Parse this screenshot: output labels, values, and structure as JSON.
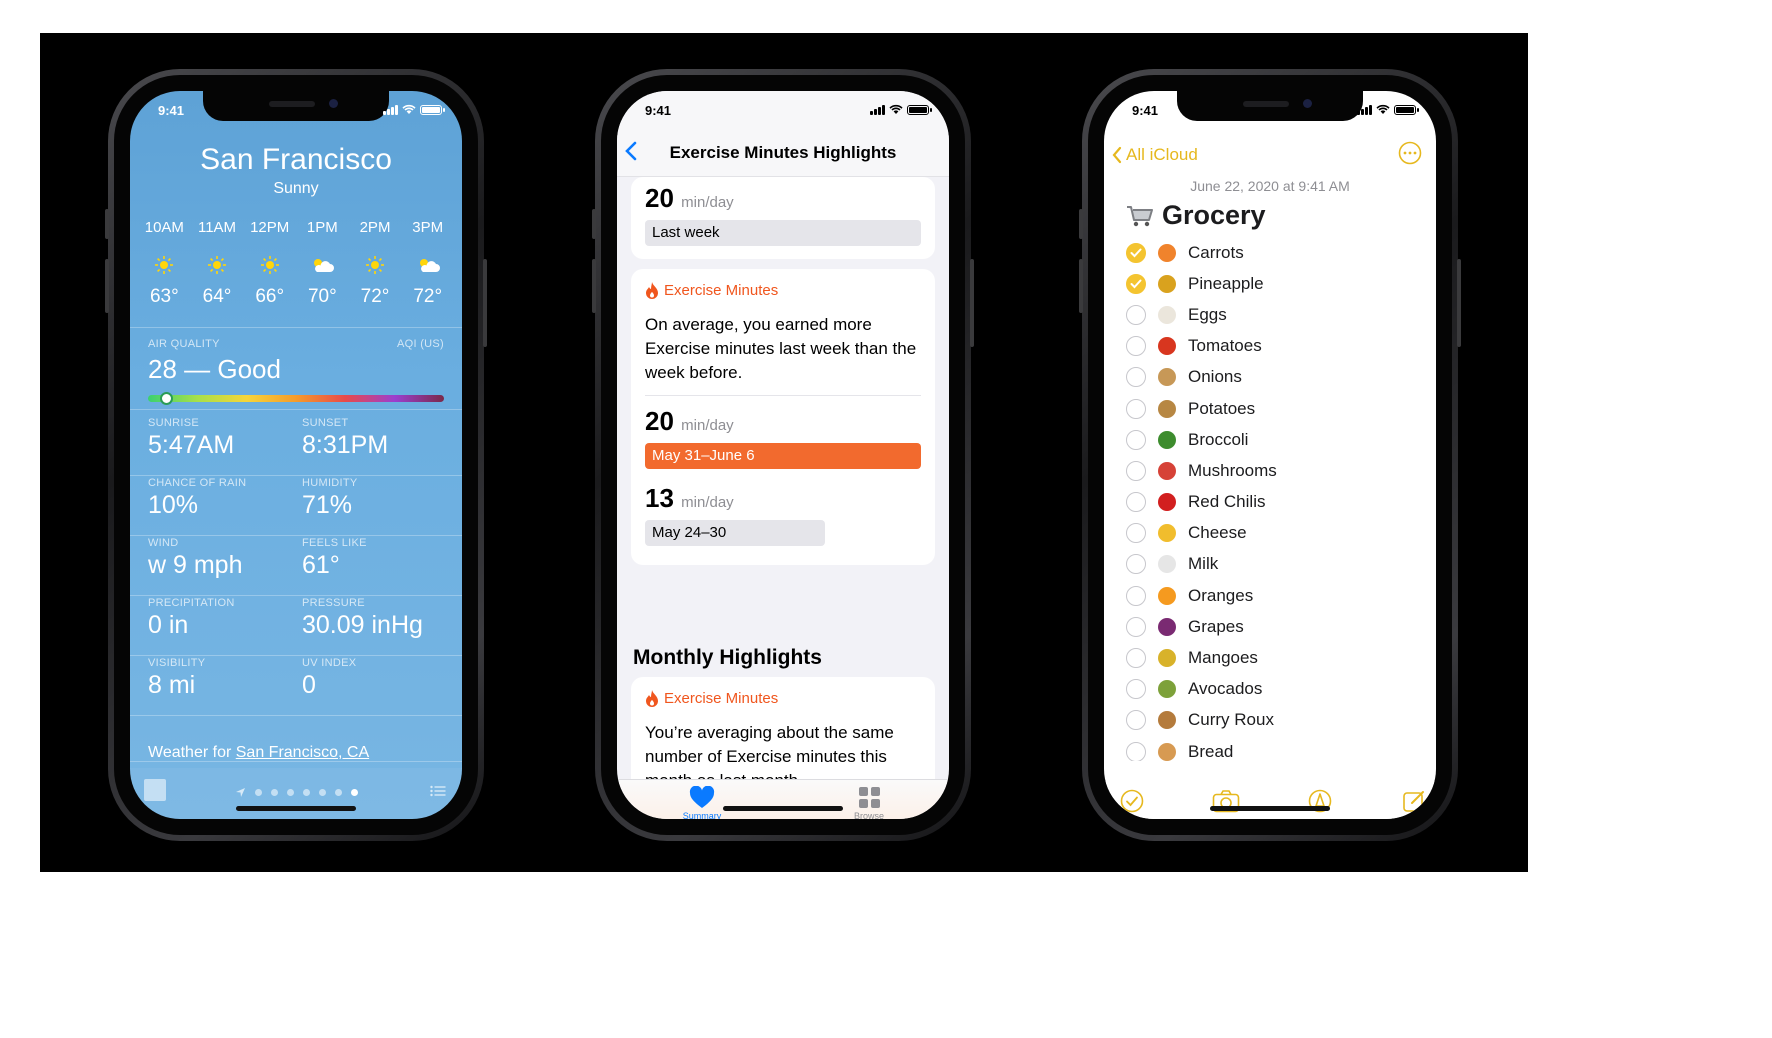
{
  "weather": {
    "time": "9:41",
    "city": "San Francisco",
    "condition": "Sunny",
    "hourly": [
      {
        "hour": "10AM",
        "icon": "sun-icon",
        "temp": "63°"
      },
      {
        "hour": "11AM",
        "icon": "sun-icon",
        "temp": "64°"
      },
      {
        "hour": "12PM",
        "icon": "sun-icon",
        "temp": "66°"
      },
      {
        "hour": "1PM",
        "icon": "partly-cloudy-icon",
        "temp": "70°"
      },
      {
        "hour": "2PM",
        "icon": "sun-icon",
        "temp": "72°"
      },
      {
        "hour": "3PM",
        "icon": "partly-cloudy-icon",
        "temp": "72°"
      }
    ],
    "air_quality": {
      "label": "AIR QUALITY",
      "scale": "AQI (US)",
      "value": "28 — Good",
      "level": 0.06
    },
    "details": [
      {
        "label": "SUNRISE",
        "value": "5:47AM"
      },
      {
        "label": "SUNSET",
        "value": "8:31PM"
      },
      {
        "label": "CHANCE OF RAIN",
        "value": "10%"
      },
      {
        "label": "HUMIDITY",
        "value": "71%"
      },
      {
        "label": "WIND",
        "value": "w 9 mph"
      },
      {
        "label": "FEELS LIKE",
        "value": "61°"
      },
      {
        "label": "PRECIPITATION",
        "value": "0 in"
      },
      {
        "label": "PRESSURE",
        "value": "30.09 inHg"
      },
      {
        "label": "VISIBILITY",
        "value": "8 mi"
      },
      {
        "label": "UV INDEX",
        "value": "0"
      }
    ],
    "footer_prefix": "Weather for ",
    "footer_link": "San Francisco, CA",
    "page_dots": 7,
    "active_dot": 6
  },
  "health": {
    "time": "9:41",
    "nav_title": "Exercise Minutes Highlights",
    "card1": {
      "stat": "20",
      "unit": "min/day",
      "pill": "Last week"
    },
    "card2": {
      "header": "Exercise Minutes",
      "body": "On average, you earned more Exercise minutes last week than the week before.",
      "stat_a": "20",
      "unit_a": "min/day",
      "pill_a": "May 31–June 6",
      "stat_b": "13",
      "unit_b": "min/day",
      "pill_b": "May 24–30"
    },
    "monthly_title": "Monthly Highlights",
    "card3": {
      "header": "Exercise Minutes",
      "body": "You’re averaging about the same number of Exercise minutes this month as last month."
    },
    "tabs": [
      {
        "label": "Summary",
        "icon": "heart-icon"
      },
      {
        "label": "Browse",
        "icon": "grid-icon"
      }
    ],
    "accent": "#f0561e",
    "blue": "#0a7aff"
  },
  "notes": {
    "time": "9:41",
    "back_label": "All iCloud",
    "date": "June 22, 2020 at 9:41 AM",
    "title": "Grocery",
    "items": [
      {
        "label": "Carrots",
        "done": true,
        "color": "#f0832c"
      },
      {
        "label": "Pineapple",
        "done": true,
        "color": "#d9a21e"
      },
      {
        "label": "Eggs",
        "done": false,
        "color": "#ebe6dc"
      },
      {
        "label": "Tomatoes",
        "done": false,
        "color": "#d8361f"
      },
      {
        "label": "Onions",
        "done": false,
        "color": "#c79857"
      },
      {
        "label": "Potatoes",
        "done": false,
        "color": "#b78743"
      },
      {
        "label": "Broccoli",
        "done": false,
        "color": "#3d8c2e"
      },
      {
        "label": "Mushrooms",
        "done": false,
        "color": "#d64237"
      },
      {
        "label": "Red Chilis",
        "done": false,
        "color": "#d21f1f"
      },
      {
        "label": "Cheese",
        "done": false,
        "color": "#f1bd2d"
      },
      {
        "label": "Milk",
        "done": false,
        "color": "#e6e6e6"
      },
      {
        "label": "Oranges",
        "done": false,
        "color": "#f59a1f"
      },
      {
        "label": "Grapes",
        "done": false,
        "color": "#7a2a72"
      },
      {
        "label": "Mangoes",
        "done": false,
        "color": "#d8b22a"
      },
      {
        "label": "Avocados",
        "done": false,
        "color": "#7da13a"
      },
      {
        "label": "Curry Roux",
        "done": false,
        "color": "#b47b3c"
      },
      {
        "label": "Bread",
        "done": false,
        "color": "#d79a52"
      }
    ],
    "accent": "#e6b81e"
  }
}
